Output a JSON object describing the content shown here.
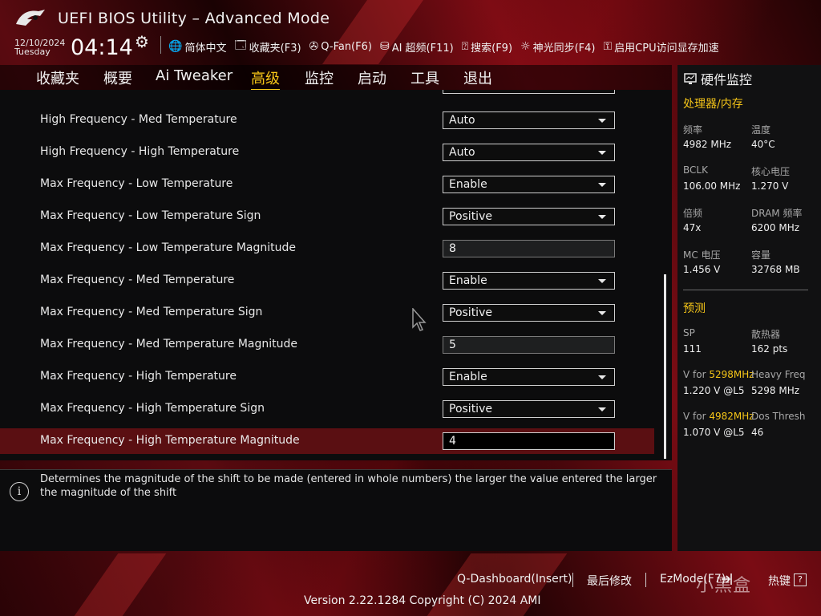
{
  "header": {
    "title": "UEFI BIOS Utility – Advanced Mode",
    "date": "12/10/2024",
    "weekday": "Tuesday",
    "time": "04:14",
    "toolbar": [
      {
        "icon": "globe-icon",
        "label": "简体中文"
      },
      {
        "icon": "bookmark-icon",
        "label": "收藏夹(F3)"
      },
      {
        "icon": "fan-icon",
        "label": "Q-Fan(F6)"
      },
      {
        "icon": "ai-chip-icon",
        "label": "AI 超频(F11)"
      },
      {
        "icon": "search-icon",
        "label": "搜索(F9)"
      },
      {
        "icon": "aura-icon",
        "label": "神光同步(F4)"
      },
      {
        "icon": "resizable-bar-icon",
        "label": "启用CPU访问显存加速"
      }
    ]
  },
  "nav": {
    "tabs": [
      "收藏夹",
      "概要",
      "Ai Tweaker",
      "高级",
      "监控",
      "启动",
      "工具",
      "退出"
    ],
    "active": "高级"
  },
  "settings": [
    {
      "label": "High Frequency - Med Temperature",
      "value": "Auto",
      "type": "dropdown"
    },
    {
      "label": "High Frequency - High Temperature",
      "value": "Auto",
      "type": "dropdown"
    },
    {
      "label": "Max Frequency - Low Temperature",
      "value": "Enable",
      "type": "dropdown"
    },
    {
      "label": "Max Frequency - Low Temperature Sign",
      "value": "Positive",
      "type": "dropdown"
    },
    {
      "label": "Max Frequency - Low Temperature Magnitude",
      "value": "8",
      "type": "input"
    },
    {
      "label": "Max Frequency - Med Temperature",
      "value": "Enable",
      "type": "dropdown"
    },
    {
      "label": "Max Frequency - Med Temperature Sign",
      "value": "Positive",
      "type": "dropdown"
    },
    {
      "label": "Max Frequency - Med Temperature Magnitude",
      "value": "5",
      "type": "input"
    },
    {
      "label": "Max Frequency - High Temperature",
      "value": "Enable",
      "type": "dropdown"
    },
    {
      "label": "Max Frequency - High Temperature Sign",
      "value": "Positive",
      "type": "dropdown"
    },
    {
      "label": "Max Frequency - High Temperature Magnitude",
      "value": "4",
      "type": "input",
      "selected": true
    }
  ],
  "help": {
    "text": "Determines the magnitude of the shift to be made (entered in whole numbers) the larger the value entered the larger the magnitude of the shift"
  },
  "monitor": {
    "title": "硬件监控",
    "cpu_section": "处理器/内存",
    "freq_label": "频率",
    "freq_value": "4982 MHz",
    "temp_label": "温度",
    "temp_value": "40°C",
    "bclk_label": "BCLK",
    "bclk_value": "106.00 MHz",
    "vcore_label": "核心电压",
    "vcore_value": "1.270 V",
    "ratio_label": "倍频",
    "ratio_value": "47x",
    "dram_label": "DRAM 频率",
    "dram_value": "6200 MHz",
    "mc_label": "MC 电压",
    "mc_value": "1.456 V",
    "cap_label": "容量",
    "cap_value": "32768 MB",
    "predict_section": "预测",
    "sp_label": "SP",
    "sp_value": "111",
    "cooler_label": "散热器",
    "cooler_value": "162 pts",
    "vfor1_prefix": "V for ",
    "vfor1_freq": "5298MHz",
    "vfor1_value": "1.220 V @L5",
    "heavy_label": "Heavy Freq",
    "heavy_value": "5298 MHz",
    "vfor2_prefix": "V for ",
    "vfor2_freq": "4982MHz",
    "vfor2_value": "1.070 V @L5",
    "dos_label": "Dos Thresh",
    "dos_value": "46"
  },
  "footer": {
    "qdash": "Q-Dashboard(Insert)",
    "last_mod": "最后修改",
    "ezmode": "EzMode(F7)",
    "hotkeys": "热键",
    "version": "Version 2.22.1284 Copyright (C) 2024 AMI",
    "watermark": "小黑盒"
  },
  "colors": {
    "accent": "#f5c518",
    "selected_row": "#5a0f12",
    "panel_bg": "#111112"
  }
}
